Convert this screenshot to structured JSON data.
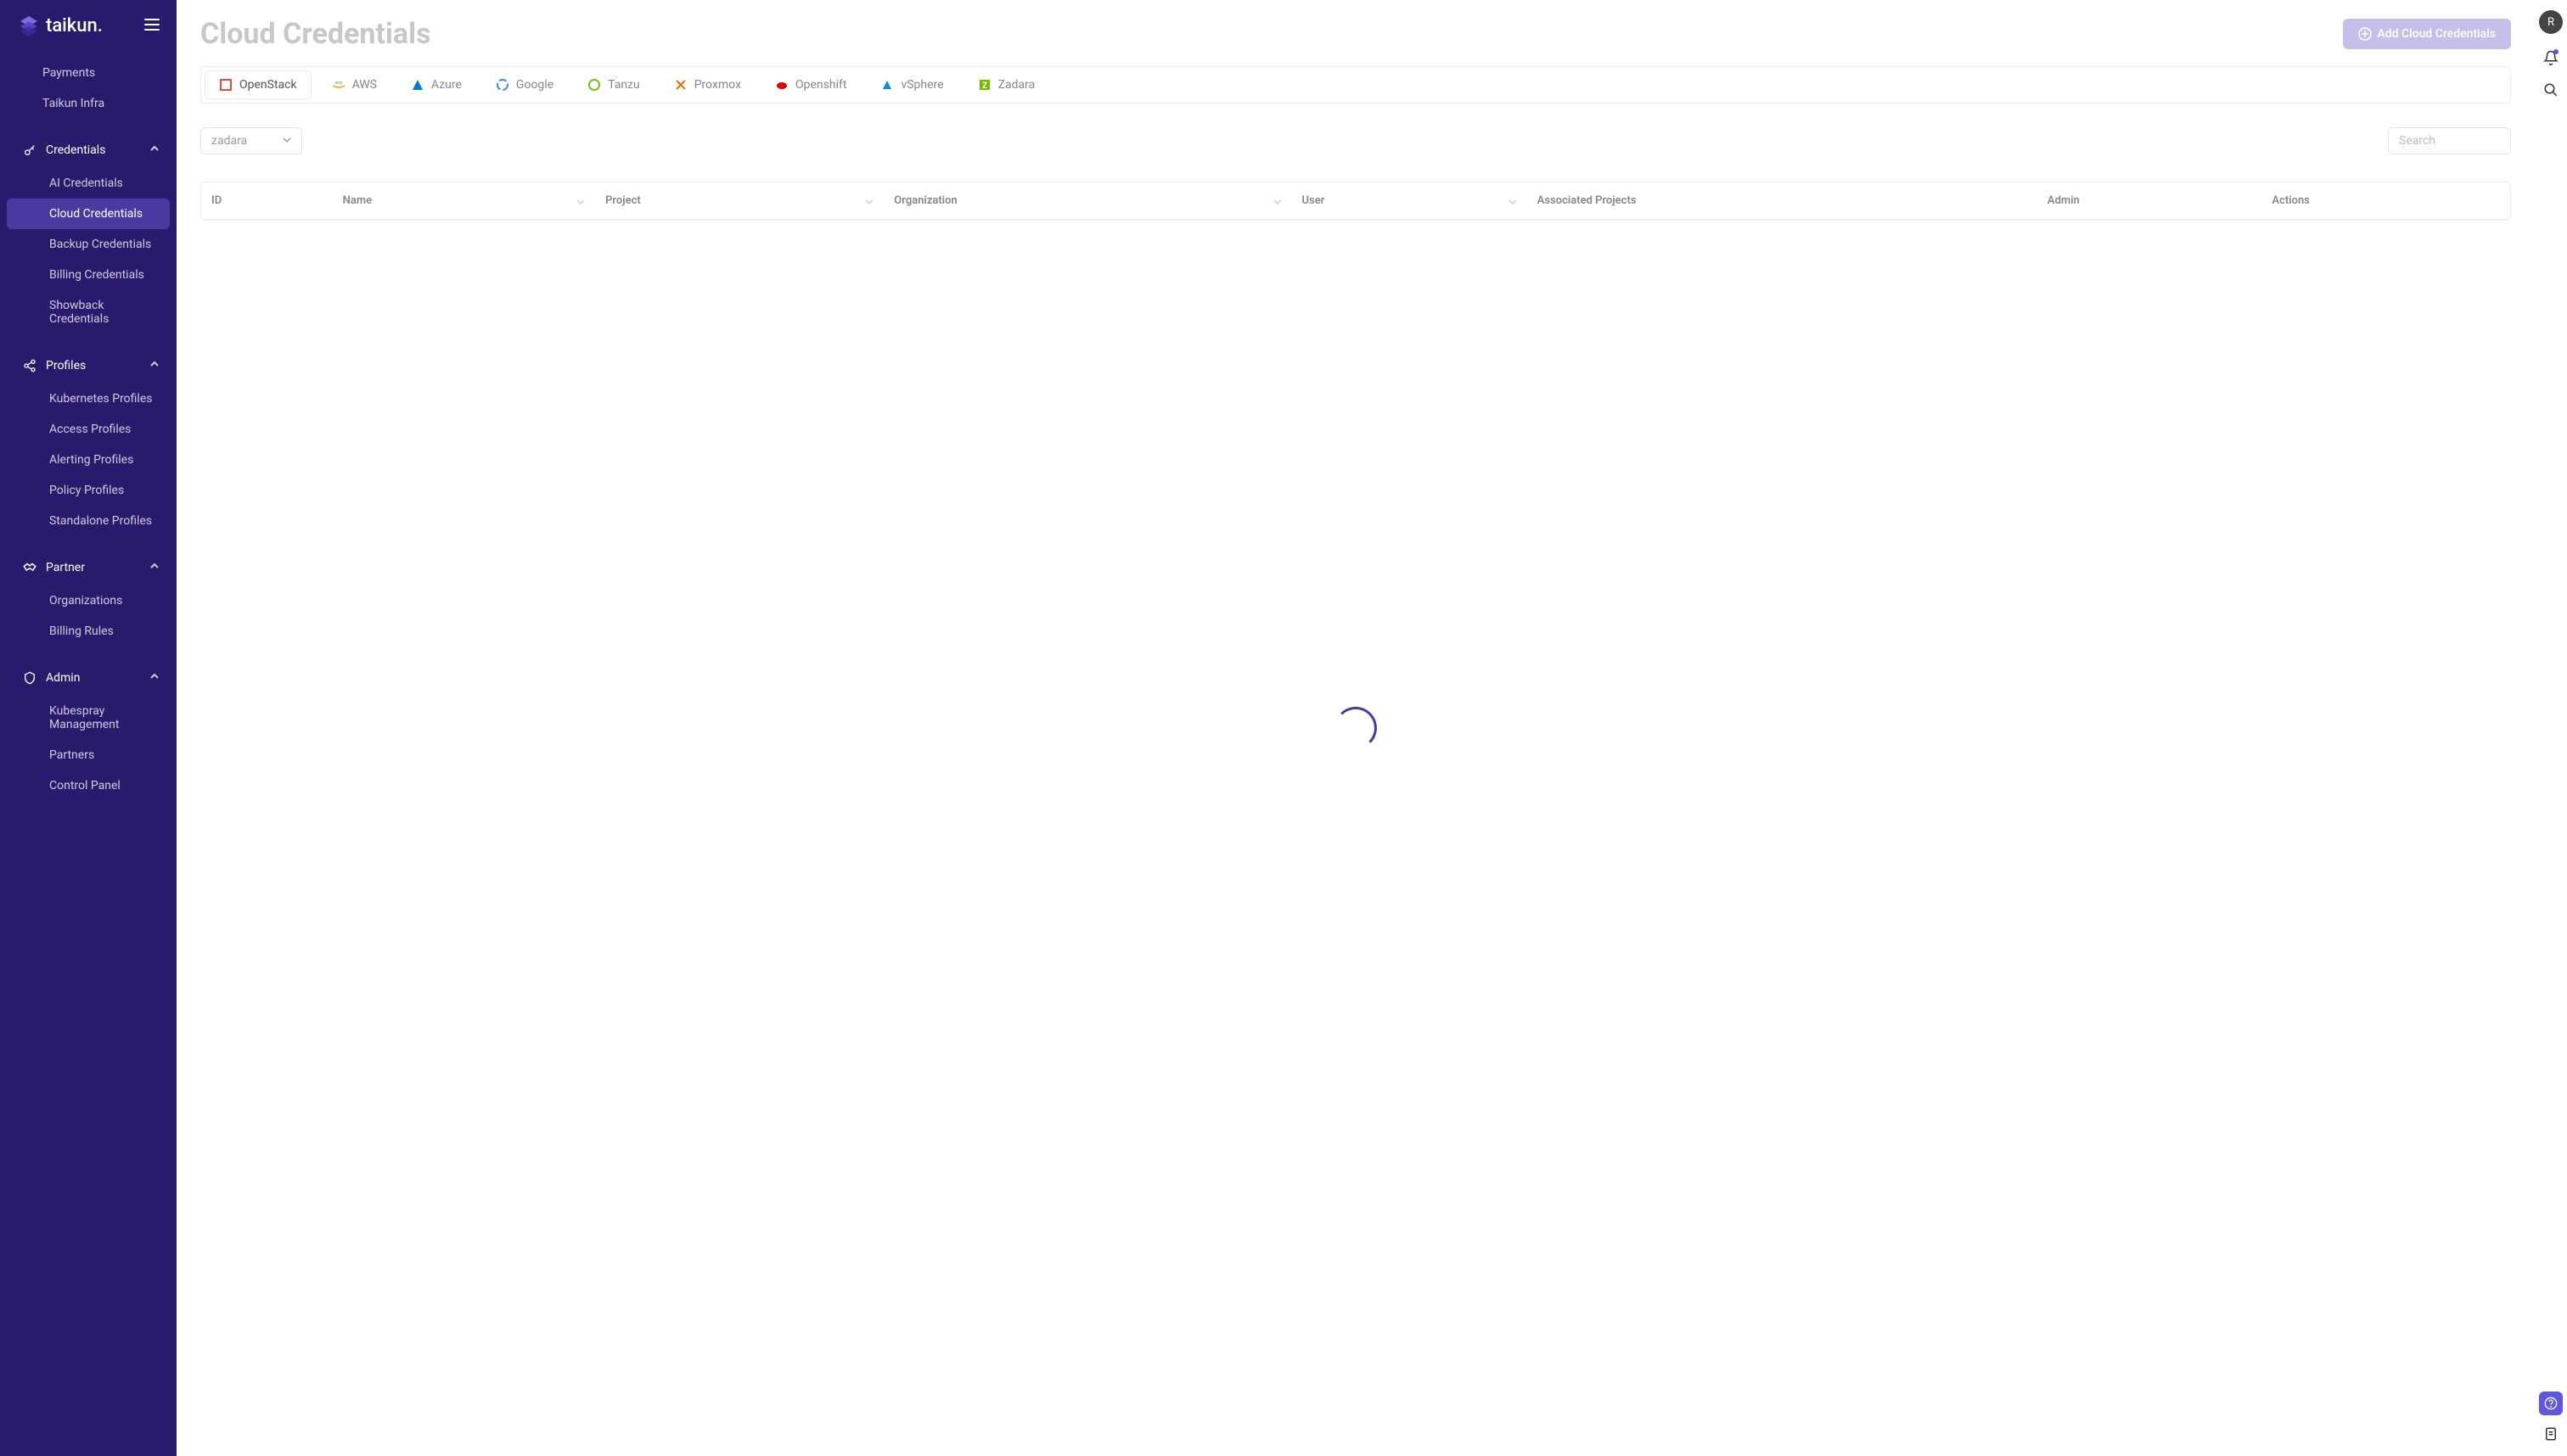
{
  "brand": {
    "name": "taikun."
  },
  "sidebar": {
    "top_items": [
      {
        "label": "Payments"
      },
      {
        "label": "Taikun Infra"
      }
    ],
    "groups": [
      {
        "name": "credentials",
        "label": "Credentials",
        "items": [
          {
            "label": "AI Credentials",
            "active": false
          },
          {
            "label": "Cloud Credentials",
            "active": true
          },
          {
            "label": "Backup Credentials",
            "active": false
          },
          {
            "label": "Billing Credentials",
            "active": false
          },
          {
            "label": "Showback Credentials",
            "active": false
          }
        ]
      },
      {
        "name": "profiles",
        "label": "Profiles",
        "items": [
          {
            "label": "Kubernetes Profiles"
          },
          {
            "label": "Access Profiles"
          },
          {
            "label": "Alerting Profiles"
          },
          {
            "label": "Policy Profiles"
          },
          {
            "label": "Standalone Profiles"
          }
        ]
      },
      {
        "name": "partner",
        "label": "Partner",
        "items": [
          {
            "label": "Organizations"
          },
          {
            "label": "Billing Rules"
          }
        ]
      },
      {
        "name": "admin",
        "label": "Admin",
        "items": [
          {
            "label": "Kubespray Management"
          },
          {
            "label": "Partners"
          },
          {
            "label": "Control Panel"
          }
        ]
      }
    ]
  },
  "page": {
    "title": "Cloud Credentials",
    "add_button_label": "Add Cloud Credentials"
  },
  "tabs": [
    {
      "label": "OpenStack",
      "active": true,
      "icon_color": "#e74c3c"
    },
    {
      "label": "AWS",
      "icon_color": "#999"
    },
    {
      "label": "Azure",
      "icon_color": "#0078d4"
    },
    {
      "label": "Google",
      "icon_color": "#4285f4"
    },
    {
      "label": "Tanzu",
      "icon_color": "#78be20"
    },
    {
      "label": "Proxmox",
      "icon_color": "#e57000"
    },
    {
      "label": "Openshift",
      "icon_color": "#ee0000"
    },
    {
      "label": "vSphere",
      "icon_color": "#0091da"
    },
    {
      "label": "Zadara",
      "icon_color": "#7ab800"
    }
  ],
  "filter": {
    "selected": "zadara",
    "search_placeholder": "Search"
  },
  "table": {
    "columns": [
      {
        "label": "ID",
        "sortable": false
      },
      {
        "label": "Name",
        "sortable": true
      },
      {
        "label": "Project",
        "sortable": true
      },
      {
        "label": "Organization",
        "sortable": true
      },
      {
        "label": "User",
        "sortable": true
      },
      {
        "label": "Associated Projects",
        "sortable": false
      },
      {
        "label": "Admin",
        "sortable": false
      },
      {
        "label": "Actions",
        "sortable": false
      }
    ]
  },
  "rail": {
    "avatar_initial": "R"
  }
}
